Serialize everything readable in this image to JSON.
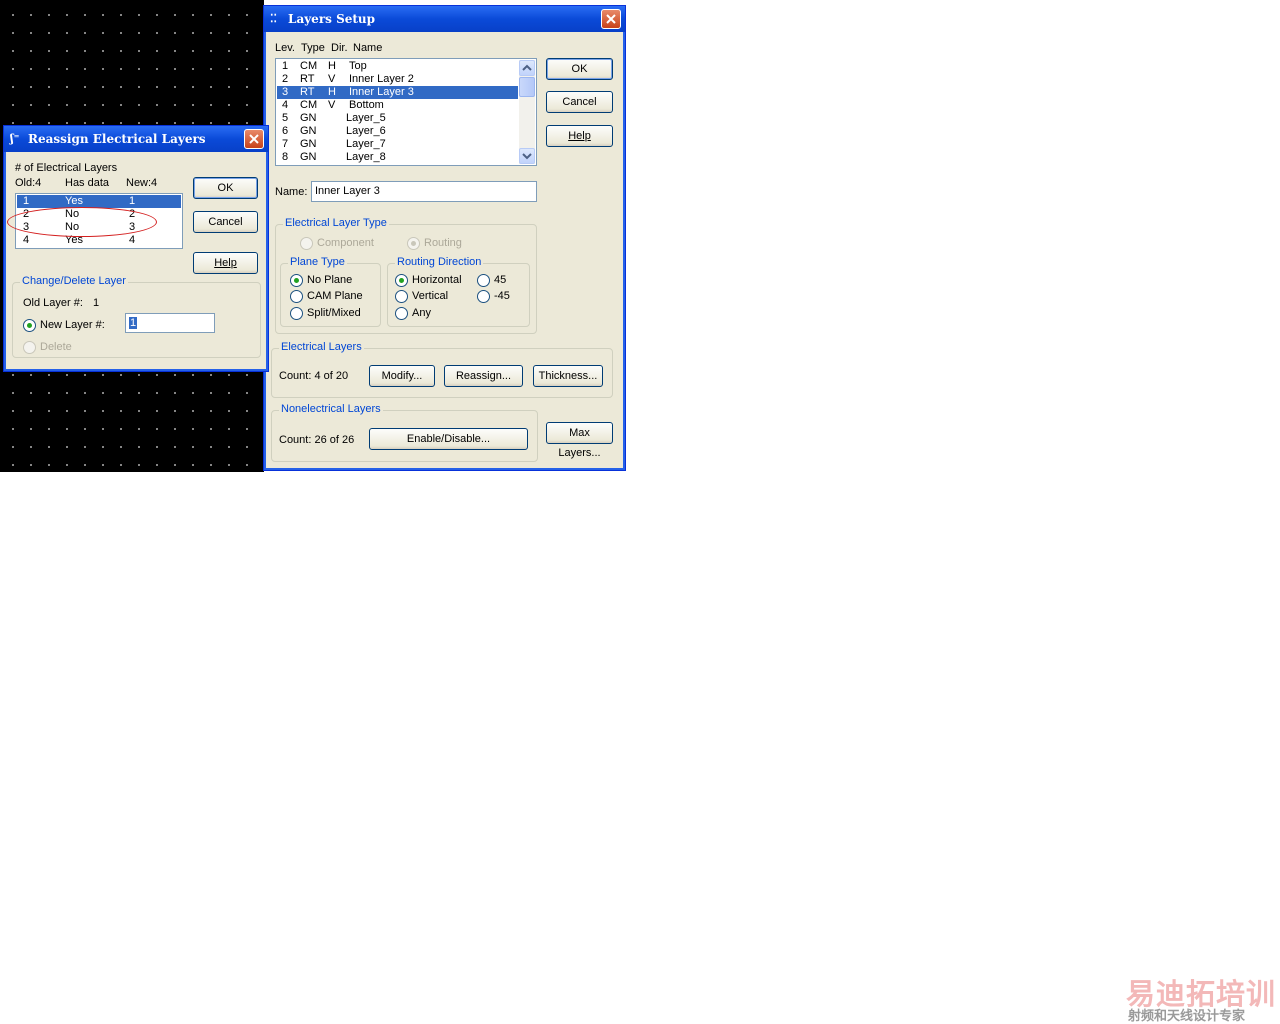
{
  "layers_setup": {
    "title": "Layers Setup",
    "columns": [
      "Lev.",
      "Type",
      "Dir.",
      "Name"
    ],
    "rows": [
      {
        "lev": "1",
        "type": "CM",
        "dir": "H",
        "name": "Top",
        "selected": false
      },
      {
        "lev": "2",
        "type": "RT",
        "dir": "V",
        "name": "Inner Layer 2",
        "selected": false
      },
      {
        "lev": "3",
        "type": "RT",
        "dir": "H",
        "name": "Inner Layer 3",
        "selected": true
      },
      {
        "lev": "4",
        "type": "CM",
        "dir": "V",
        "name": "Bottom",
        "selected": false
      },
      {
        "lev": "5",
        "type": "GN",
        "dir": "",
        "name": "Layer_5",
        "selected": false
      },
      {
        "lev": "6",
        "type": "GN",
        "dir": "",
        "name": "Layer_6",
        "selected": false
      },
      {
        "lev": "7",
        "type": "GN",
        "dir": "",
        "name": "Layer_7",
        "selected": false
      },
      {
        "lev": "8",
        "type": "GN",
        "dir": "",
        "name": "Layer_8",
        "selected": false
      }
    ],
    "ok_label": "OK",
    "cancel_label": "Cancel",
    "help_label": "Help",
    "name_label": "Name:",
    "name_value": "Inner Layer 3",
    "electrical_layer_type": {
      "label": "Electrical  Layer Type",
      "component": "Component",
      "routing": "Routing"
    },
    "plane_type": {
      "label": "Plane Type",
      "options": [
        "No Plane",
        "CAM Plane",
        "Split/Mixed"
      ],
      "selected": "No Plane"
    },
    "routing_direction": {
      "label": "Routing Direction",
      "horizontal": "Horizontal",
      "vertical": "Vertical",
      "any": "Any",
      "deg45": "45",
      "degm45": "-45",
      "selected": "Horizontal"
    },
    "electrical_layers": {
      "label": "Electrical Layers",
      "count": "Count:  4 of 20",
      "modify": "Modify...",
      "reassign": "Reassign...",
      "thickness": "Thickness..."
    },
    "nonelectrical_layers": {
      "label": "Nonelectrical Layers",
      "count": "Count: 26 of 26",
      "enable_disable": "Enable/Disable...",
      "max_layers": "Max Layers..."
    }
  },
  "reassign": {
    "title": "Reassign Electrical Layers",
    "num_label": "# of Electrical Layers",
    "old_label": "Old:4",
    "has_data_label": "Has data",
    "new_label": "New:4",
    "rows": [
      {
        "old": "1",
        "has_data": "Yes",
        "new": "1",
        "selected": true
      },
      {
        "old": "2",
        "has_data": "No",
        "new": "2",
        "selected": false
      },
      {
        "old": "3",
        "has_data": "No",
        "new": "3",
        "selected": false
      },
      {
        "old": "4",
        "has_data": "Yes",
        "new": "4",
        "selected": false
      }
    ],
    "ok_label": "OK",
    "cancel_label": "Cancel",
    "help_label": "Help",
    "change_delete_label": "Change/Delete Layer",
    "old_layer_label": "Old Layer #:",
    "old_layer_value": "1",
    "new_layer_label": "New Layer #:",
    "new_layer_value": "1",
    "delete_label": "Delete"
  },
  "watermark": {
    "line1": "易迪拓培训",
    "line2": "射频和天线设计专家"
  }
}
